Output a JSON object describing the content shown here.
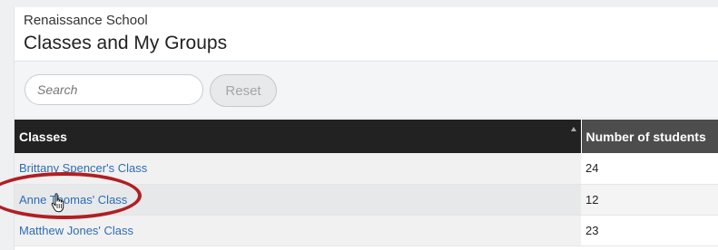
{
  "header": {
    "school_name": "Renaissance School",
    "title": "Classes and My Groups"
  },
  "toolbar": {
    "search_placeholder": "Search",
    "reset_label": "Reset"
  },
  "table": {
    "columns": [
      "Classes",
      "Number of students"
    ],
    "rows": [
      {
        "name": "Brittany Spencer's Class",
        "students": "24"
      },
      {
        "name": "Anne Thomas' Class",
        "students": "12"
      },
      {
        "name": "Matthew Jones' Class",
        "students": "23"
      }
    ]
  },
  "colors": {
    "link": "#2f6db5",
    "header_dark": "#222222",
    "annotation": "#b01f23"
  },
  "icons": [
    "sort-ascending-icon",
    "hand-pointer-cursor-icon"
  ]
}
